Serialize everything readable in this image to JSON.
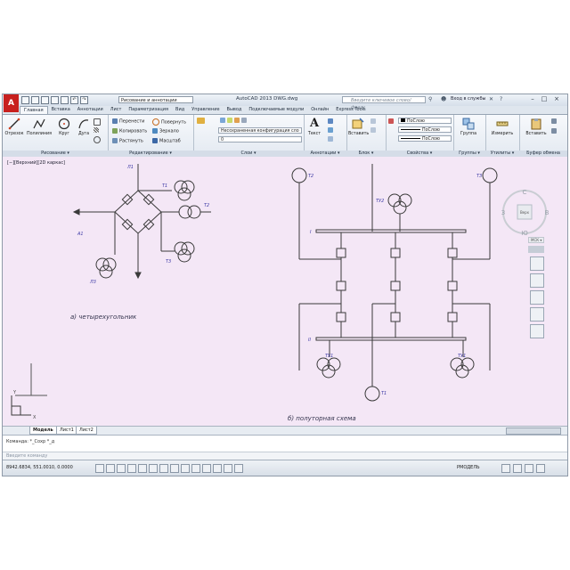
{
  "titlebar": {
    "app_logo": "A",
    "workspace": "Рисование и аннотации",
    "title": "AutoCAD 2013    DWG.dwg",
    "search_placeholder": "Введите ключевое слово/фразу",
    "login": "Вход в службы"
  },
  "ribbon_tabs": [
    "Главная",
    "Вставка",
    "Аннотации",
    "Лист",
    "Параметризация",
    "Вид",
    "Управление",
    "Вывод",
    "Подключаемые модули",
    "Онлайн",
    "Express Tools"
  ],
  "panels": {
    "draw": {
      "title": "Рисование ▾",
      "tools": [
        "Отрезок",
        "Полилиния",
        "Круг",
        "Дуга"
      ]
    },
    "modify": {
      "title": "Редактирование ▾",
      "tools": [
        "Перенести",
        "Повернуть",
        "Копировать",
        "Зеркало",
        "Растянуть",
        "Масштаб"
      ]
    },
    "layers": {
      "title": "Слои ▾",
      "combo1": "Несохраненная конфигурация сло",
      "combo2": "0"
    },
    "annotation": {
      "title": "Аннотации ▾",
      "tools": [
        "Текст"
      ]
    },
    "block": {
      "title": "Блок ▾",
      "tools": [
        "Вставить"
      ]
    },
    "properties": {
      "title": "Свойства ▾",
      "rows": [
        "ПоСлою",
        "ПоСлою",
        "ПоСлою"
      ]
    },
    "groups": {
      "title": "Группы ▾",
      "tools": [
        "Группа"
      ]
    },
    "utilities": {
      "title": "Утилиты ▾",
      "tools": [
        "Измерить"
      ]
    },
    "clipboard": {
      "title": "Буфер обмена",
      "tools": [
        "Вставить"
      ]
    }
  },
  "viewport": {
    "label": "[−][Верхний][2D каркас]"
  },
  "viewcube": {
    "north": "С",
    "west": "З",
    "east": "В",
    "south": "Ю",
    "top": "Верх",
    "wcs": "МСК ▾"
  },
  "drawing": {
    "left": {
      "l1": "Л1",
      "t1": "Т1",
      "t2": "Т2",
      "t3": "Т3",
      "a1": "А1",
      "l3": "Л3",
      "caption": "а) четырехугольник"
    },
    "right": {
      "t2": "Т2",
      "t3": "Т3",
      "t1": "Т1",
      "tv1": "ТУ1",
      "tv2": "ТУ2",
      "bus1": "I",
      "bus2": "II",
      "caption": "б) полуторная схема"
    },
    "ucs": {
      "x": "X",
      "y": "Y"
    }
  },
  "layout_tabs": [
    "Модель",
    "Лист1",
    "Лист2"
  ],
  "command": {
    "history": "Команда: *_Сохр *_д",
    "prompt": "Введите команду"
  },
  "status": {
    "coords": "8942.6834, 551.0010, 0.0000",
    "right": "РМОДЕЛЬ"
  },
  "colors": {
    "accent": "#c8201e",
    "canvas_bg": "#f4e7f6",
    "drawing_line": "#3a3a3a",
    "label_blue": "#3d3aa6"
  }
}
